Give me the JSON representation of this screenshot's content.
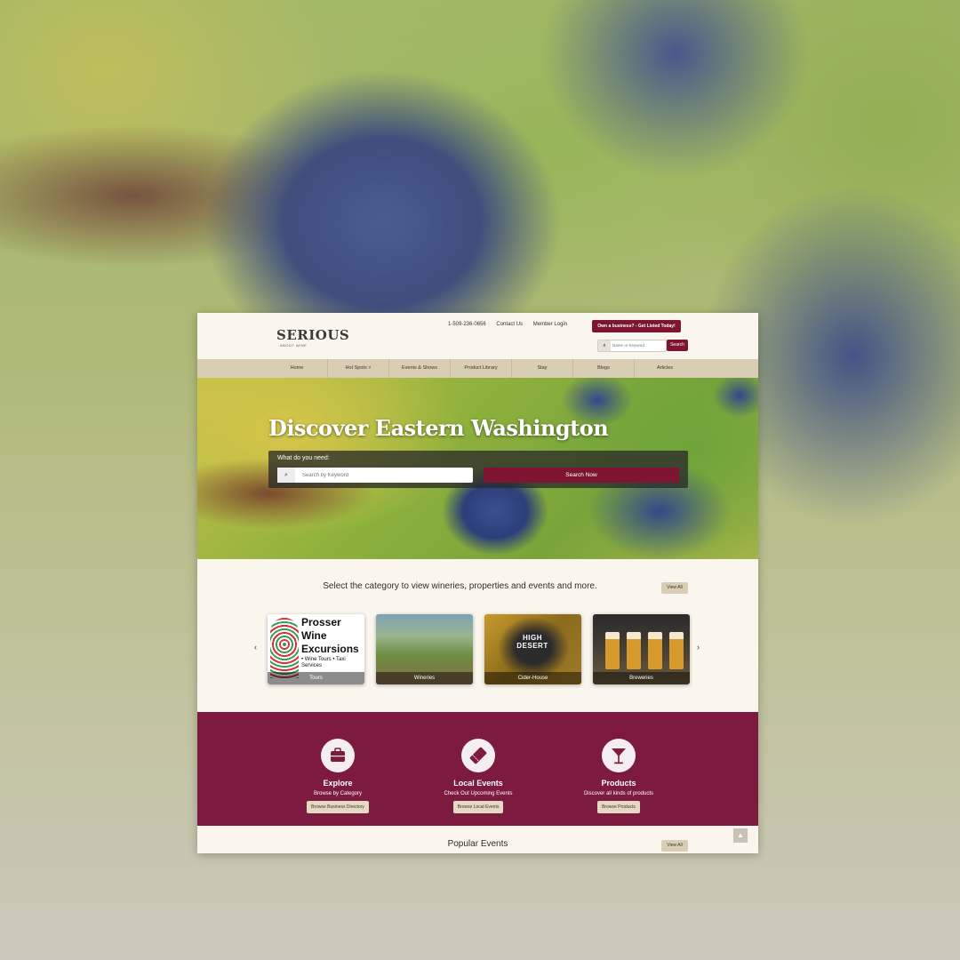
{
  "header": {
    "logo_main": "SERIOUS",
    "logo_sub": "ABOUT WINE",
    "phone": "1-509-236-0656",
    "contact_link": "Contact Us",
    "member_login": "Member Login",
    "cta": "Own a business? - Get Listed Today!",
    "search_placeholder": "Name or Keyword",
    "search_button": "Search"
  },
  "nav": [
    "Home",
    "Hot Spots ˅",
    "Events & Shows",
    "Product Library",
    "Stay",
    "Blogs",
    "Articles"
  ],
  "hero": {
    "title": "Discover Eastern Washington",
    "prompt": "What do you need:",
    "search_placeholder": "Search by Keyword",
    "search_button": "Search Now"
  },
  "categories": {
    "heading": "Select the category to view wineries, properties and events and more.",
    "view_all": "View All",
    "prev": "‹",
    "next": "›",
    "cards": [
      {
        "label": "Tours",
        "title_lines": "Prosser Wine Excursions",
        "sub": "• Wine Tours • Taxi Services"
      },
      {
        "label": "Wineries"
      },
      {
        "label": "Cider-House",
        "badge": "HIGH DESERT"
      },
      {
        "label": "Breweries"
      }
    ]
  },
  "features": [
    {
      "title": "Explore",
      "subtitle": "Browse by Category",
      "button": "Browse Business Directory",
      "icon": "briefcase-icon"
    },
    {
      "title": "Local Events",
      "subtitle": "Check Out Upcoming Events",
      "button": "Browse Local Events",
      "icon": "ticket-icon"
    },
    {
      "title": "Products",
      "subtitle": "Discover all kinds of products",
      "button": "Browse Products",
      "icon": "cocktail-glass-icon"
    }
  ],
  "popular": {
    "heading": "Popular Events",
    "view_all": "View All"
  },
  "colors": {
    "brand": "#7d1530",
    "band": "#7d1a40",
    "nav_bg": "#d9cdb4",
    "page_bg": "#faf6ee"
  }
}
